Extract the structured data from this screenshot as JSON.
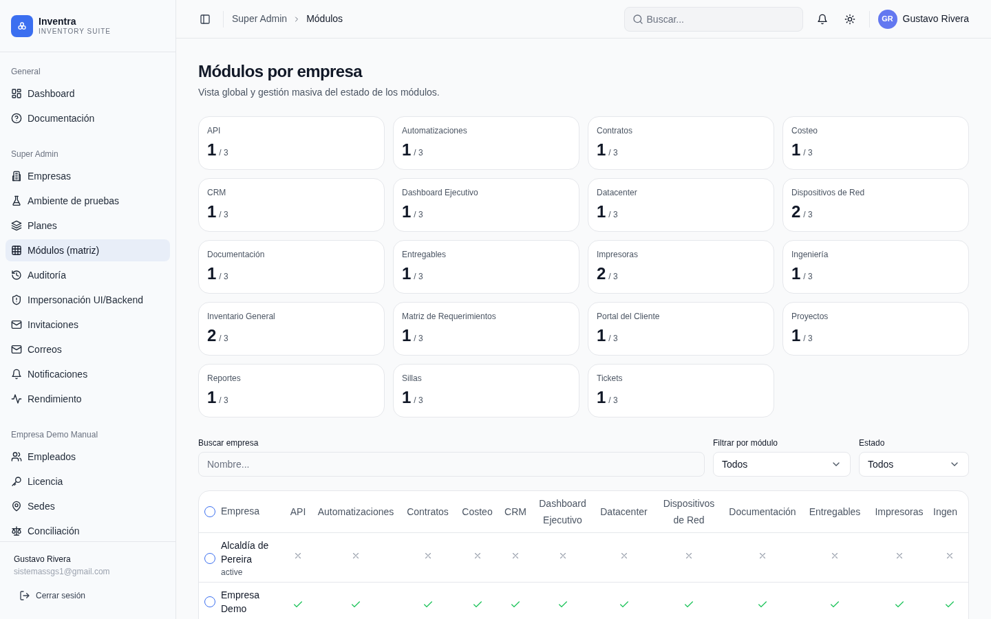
{
  "brand": {
    "name": "Inventra",
    "subtitle": "INVENTORY SUITE"
  },
  "sidebar": {
    "sections": [
      {
        "title": "General",
        "items": [
          {
            "label": "Dashboard",
            "selected": false
          },
          {
            "label": "Documentación",
            "selected": false
          }
        ]
      },
      {
        "title": "Super Admin",
        "items": [
          {
            "label": "Empresas",
            "selected": false
          },
          {
            "label": "Ambiente de pruebas",
            "selected": false
          },
          {
            "label": "Planes",
            "selected": false
          },
          {
            "label": "Módulos (matriz)",
            "selected": true
          },
          {
            "label": "Auditoría",
            "selected": false
          },
          {
            "label": "Impersonación UI/Backend",
            "selected": false
          },
          {
            "label": "Invitaciones",
            "selected": false
          },
          {
            "label": "Correos",
            "selected": false
          },
          {
            "label": "Notificaciones",
            "selected": false
          },
          {
            "label": "Rendimiento",
            "selected": false
          }
        ]
      },
      {
        "title": "Empresa Demo Manual",
        "items": [
          {
            "label": "Empleados",
            "selected": false
          },
          {
            "label": "Licencia",
            "selected": false
          },
          {
            "label": "Sedes",
            "selected": false
          },
          {
            "label": "Conciliación",
            "selected": false
          }
        ]
      }
    ],
    "user": {
      "name": "Gustavo Rivera",
      "email": "sistemassgs1@gmail.com"
    },
    "logout": "Cerrar sesión"
  },
  "topbar": {
    "breadcrumb": [
      "Super Admin",
      "Módulos"
    ],
    "search": {
      "placeholder": "Buscar..."
    },
    "avatar": "GR",
    "user": "Gustavo Rivera"
  },
  "page": {
    "title": "Módulos por empresa",
    "subtitle": "Vista global y gestión masiva del estado de los módulos."
  },
  "modules": [
    {
      "name": "API",
      "count": "1",
      "total": "/ 3"
    },
    {
      "name": "Automatizaciones",
      "count": "1",
      "total": "/ 3"
    },
    {
      "name": "Contratos",
      "count": "1",
      "total": "/ 3"
    },
    {
      "name": "Costeo",
      "count": "1",
      "total": "/ 3"
    },
    {
      "name": "CRM",
      "count": "1",
      "total": "/ 3"
    },
    {
      "name": "Dashboard Ejecutivo",
      "count": "1",
      "total": "/ 3"
    },
    {
      "name": "Datacenter",
      "count": "1",
      "total": "/ 3"
    },
    {
      "name": "Dispositivos de Red",
      "count": "2",
      "total": "/ 3"
    },
    {
      "name": "Documentación",
      "count": "1",
      "total": "/ 3"
    },
    {
      "name": "Entregables",
      "count": "1",
      "total": "/ 3"
    },
    {
      "name": "Impresoras",
      "count": "2",
      "total": "/ 3"
    },
    {
      "name": "Ingeniería",
      "count": "1",
      "total": "/ 3"
    },
    {
      "name": "Inventario General",
      "count": "2",
      "total": "/ 3"
    },
    {
      "name": "Matriz de Requerimientos",
      "count": "1",
      "total": "/ 3"
    },
    {
      "name": "Portal del Cliente",
      "count": "1",
      "total": "/ 3"
    },
    {
      "name": "Proyectos",
      "count": "1",
      "total": "/ 3"
    },
    {
      "name": "Reportes",
      "count": "1",
      "total": "/ 3"
    },
    {
      "name": "Sillas",
      "count": "1",
      "total": "/ 3"
    },
    {
      "name": "Tickets",
      "count": "1",
      "total": "/ 3"
    }
  ],
  "filters": {
    "search": {
      "label": "Buscar empresa",
      "placeholder": "Nombre..."
    },
    "module": {
      "label": "Filtrar por módulo",
      "value": "Todos"
    },
    "status": {
      "label": "Estado",
      "value": "Todos"
    }
  },
  "table": {
    "select_all": {
      "checked": false
    },
    "columns": [
      "Empresa",
      "API",
      "Automatizaciones",
      "Contratos",
      "Costeo",
      "CRM",
      "Dashboard Ejecutivo",
      "Datacenter",
      "Dispositivos de Red",
      "Documentación",
      "Entregables",
      "Impresoras",
      "Ingen"
    ],
    "rows": [
      {
        "name": "Alcaldía de Pereira",
        "status": "active",
        "checked": false,
        "cells": [
          false,
          false,
          false,
          false,
          false,
          false,
          false,
          false,
          false,
          false,
          false,
          false
        ]
      },
      {
        "name": "Empresa Demo",
        "checked": false,
        "cells": [
          true,
          true,
          true,
          true,
          true,
          true,
          true,
          true,
          true,
          true,
          true,
          true
        ]
      }
    ]
  }
}
